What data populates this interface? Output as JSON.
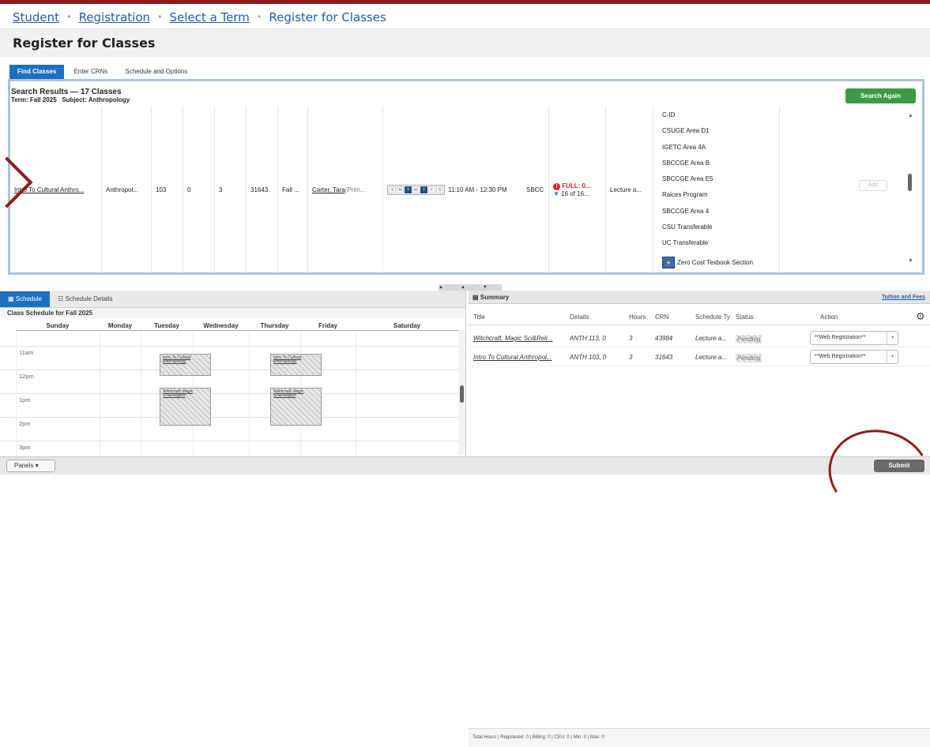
{
  "breadcrumb": {
    "items": [
      "Student",
      "Registration",
      "Select a Term",
      "Register for Classes"
    ]
  },
  "page_title": "Register for Classes",
  "tabs": [
    "Find Classes",
    "Enter CRNs",
    "Schedule and Options"
  ],
  "results": {
    "title": "Search Results — 17 Classes",
    "term_label": "Term: Fall 2025",
    "subject_label": "Subject: Anthropology",
    "search_again": "Search Again",
    "row": {
      "title": "Intro To Cultural Anthro...",
      "subject": "Anthropol...",
      "course_number": "103",
      "section": "0",
      "hours": "3",
      "crn": "31643",
      "term": "Fall ...",
      "instructor": "Carter, Tara",
      "instructor_suffix": " (Prim...",
      "days": [
        "S",
        "M",
        "T",
        "W",
        "T",
        "F",
        "S"
      ],
      "active_days": [
        2,
        4
      ],
      "time": "11:10 AM - 12:30 PM",
      "campus": "SBCC",
      "status_full": "FULL: 0...",
      "waitlist": "16 of 16...",
      "schedule_type": "Lecture a...",
      "attributes": [
        "C-ID",
        "CSUGE Area D1",
        "IGETC Area 4A",
        "SBCCGE Area B",
        "SBCCGE Area E5",
        "Raices Program",
        "SBCCGE Area 4",
        "CSU Transferable",
        "UC Transferable",
        "Zero Cost Texbook Section"
      ],
      "add": "Add"
    }
  },
  "schedule": {
    "tab_schedule": "Schedule",
    "tab_details": "Schedule Details",
    "title": "Class Schedule for Fall 2025",
    "days": [
      "Sunday",
      "Monday",
      "Tuesday",
      "Wednesday",
      "Thursday",
      "Friday",
      "Saturday"
    ],
    "hours": [
      "11am",
      "12pm",
      "1pm",
      "2pm",
      "3pm"
    ],
    "block_intro": "Intro To Cultural Anthropology",
    "block_witch": "Witchcraft, Magic Sci&Religion"
  },
  "summary": {
    "title": "Summary",
    "tuition_link": "Tuition and Fees",
    "columns": [
      "Title",
      "Details",
      "Hours",
      "CRN",
      "Schedule Ty",
      "Status",
      "Action"
    ],
    "rows": [
      {
        "title": "Witchcraft, Magic Sci&Reli...",
        "details": "ANTH 113, 0",
        "hours": "3",
        "crn": "43984",
        "type": "Lecture a...",
        "status": "Pending",
        "action": "**Web Registration**"
      },
      {
        "title": "Intro To Cultural Anthropol...",
        "details": "ANTH 103, 0",
        "hours": "3",
        "crn": "31643",
        "type": "Lecture a...",
        "status": "Pending",
        "action": "**Web Registration**"
      }
    ],
    "footer": "Total Hours | Registered: 0 | Billing: 0 | CEU: 0 | Min: 0 | Max: 0"
  },
  "bottom": {
    "panels": "Panels",
    "submit": "Submit"
  },
  "colors": {
    "accent": "#8f1b1b",
    "primary": "#1f6fbf",
    "green": "#3c9a45"
  }
}
